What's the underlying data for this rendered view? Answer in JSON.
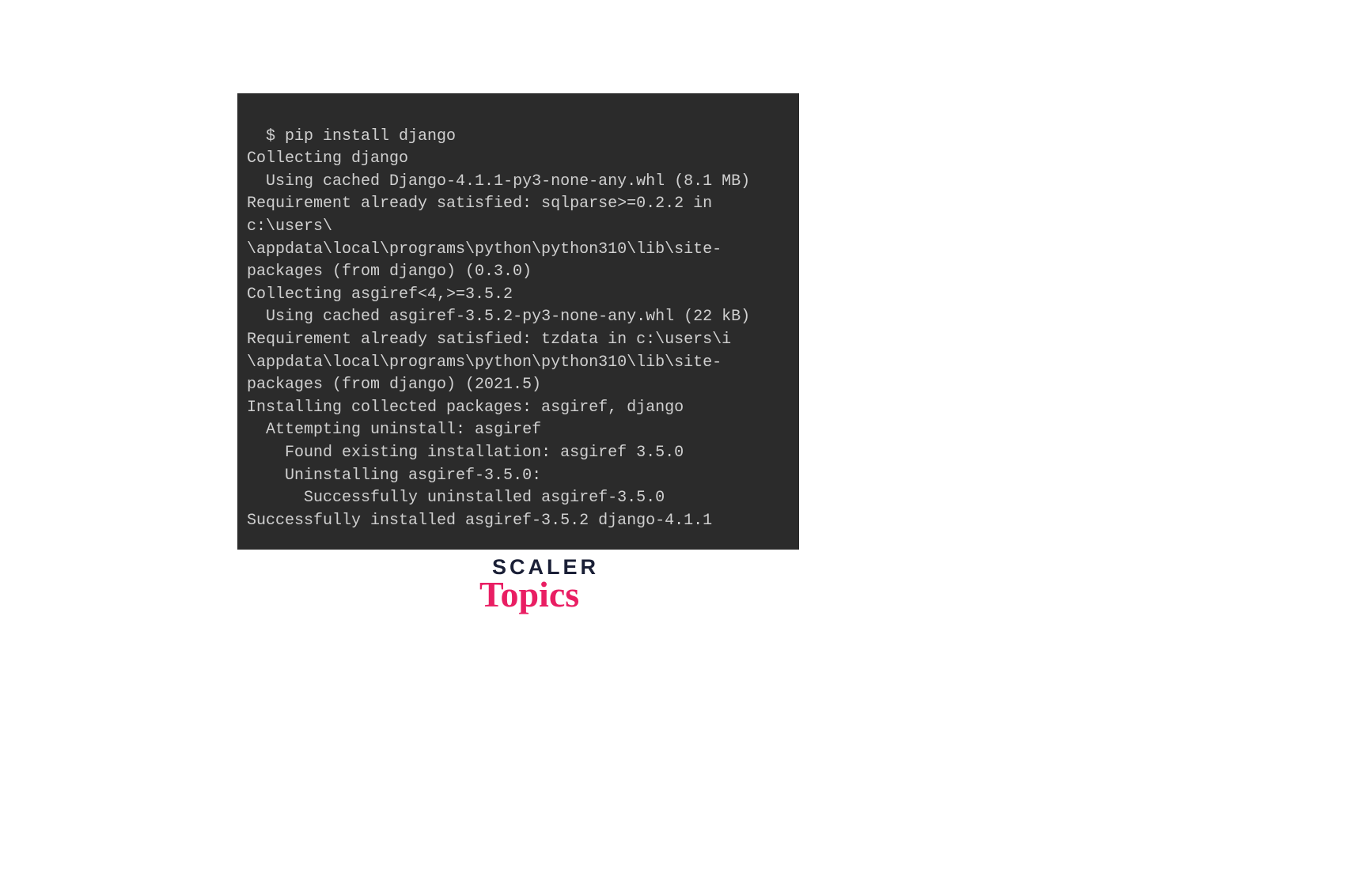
{
  "terminal": {
    "lines": "$ pip install django\nCollecting django\n  Using cached Django-4.1.1-py3-none-any.whl (8.1 MB)\nRequirement already satisfied: sqlparse>=0.2.2 in c:\\users\\      \\appdata\\local\\programs\\python\\python310\\lib\\site-packages (from django) (0.3.0)\nCollecting asgiref<4,>=3.5.2\n  Using cached asgiref-3.5.2-py3-none-any.whl (22 kB)\nRequirement already satisfied: tzdata in c:\\users\\i    \\appdata\\local\\programs\\python\\python310\\lib\\site-packages (from django) (2021.5)\nInstalling collected packages: asgiref, django\n  Attempting uninstall: asgiref\n    Found existing installation: asgiref 3.5.0\n    Uninstalling asgiref-3.5.0:\n      Successfully uninstalled asgiref-3.5.0\nSuccessfully installed asgiref-3.5.2 django-4.1.1"
  },
  "logo": {
    "line1": "SCALER",
    "line2": "Topics"
  }
}
